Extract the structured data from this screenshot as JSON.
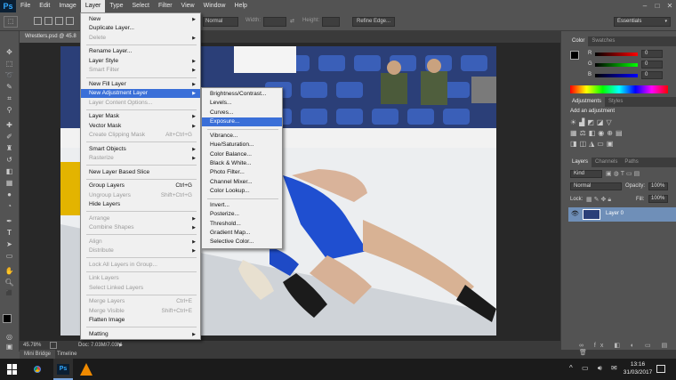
{
  "menubar": {
    "logo": "Ps",
    "items": [
      "File",
      "Edit",
      "Image",
      "Layer",
      "Type",
      "Select",
      "Filter",
      "View",
      "Window",
      "Help"
    ]
  },
  "options": {
    "mode_value": "Normal",
    "width_label": "Width:",
    "height_label": "Height:",
    "refine_edge": "Refine Edge...",
    "workspace": "Essentials"
  },
  "document": {
    "tab_title": "Wrestlers.psd @ 45.8",
    "zoom": "45.78%",
    "doc_size": "Doc: 7.03M/7.03M"
  },
  "bottom_tabs": {
    "mini_bridge": "Mini Bridge",
    "timeline": "Timeline"
  },
  "layer_menu": [
    {
      "label": "New",
      "submenu": true
    },
    {
      "label": "Duplicate Layer..."
    },
    {
      "label": "Delete",
      "submenu": true,
      "disabled": true
    },
    {
      "sep": true
    },
    {
      "label": "Rename Layer..."
    },
    {
      "label": "Layer Style",
      "submenu": true
    },
    {
      "label": "Smart Filter",
      "submenu": true,
      "disabled": true
    },
    {
      "sep": true
    },
    {
      "label": "New Fill Layer",
      "submenu": true
    },
    {
      "label": "New Adjustment Layer",
      "submenu": true,
      "highlight": true
    },
    {
      "label": "Layer Content Options...",
      "disabled": true
    },
    {
      "sep": true
    },
    {
      "label": "Layer Mask",
      "submenu": true
    },
    {
      "label": "Vector Mask",
      "submenu": true
    },
    {
      "label": "Create Clipping Mask",
      "shortcut": "Alt+Ctrl+G",
      "disabled": true
    },
    {
      "sep": true
    },
    {
      "label": "Smart Objects",
      "submenu": true
    },
    {
      "label": "Rasterize",
      "submenu": true,
      "disabled": true
    },
    {
      "sep": true
    },
    {
      "label": "New Layer Based Slice"
    },
    {
      "sep": true
    },
    {
      "label": "Group Layers",
      "shortcut": "Ctrl+G"
    },
    {
      "label": "Ungroup Layers",
      "shortcut": "Shift+Ctrl+G",
      "disabled": true
    },
    {
      "label": "Hide Layers"
    },
    {
      "sep": true
    },
    {
      "label": "Arrange",
      "submenu": true,
      "disabled": true
    },
    {
      "label": "Combine Shapes",
      "submenu": true,
      "disabled": true
    },
    {
      "sep": true
    },
    {
      "label": "Align",
      "submenu": true,
      "disabled": true
    },
    {
      "label": "Distribute",
      "submenu": true,
      "disabled": true
    },
    {
      "sep": true
    },
    {
      "label": "Lock All Layers in Group...",
      "disabled": true
    },
    {
      "sep": true
    },
    {
      "label": "Link Layers",
      "disabled": true
    },
    {
      "label": "Select Linked Layers",
      "disabled": true
    },
    {
      "sep": true
    },
    {
      "label": "Merge Layers",
      "shortcut": "Ctrl+E",
      "disabled": true
    },
    {
      "label": "Merge Visible",
      "shortcut": "Shift+Ctrl+E",
      "disabled": true
    },
    {
      "label": "Flatten Image"
    },
    {
      "sep": true
    },
    {
      "label": "Matting",
      "submenu": true
    }
  ],
  "adjustment_submenu": [
    {
      "label": "Brightness/Contrast..."
    },
    {
      "label": "Levels..."
    },
    {
      "label": "Curves..."
    },
    {
      "label": "Exposure...",
      "highlight": true
    },
    {
      "sep": true
    },
    {
      "label": "Vibrance..."
    },
    {
      "label": "Hue/Saturation..."
    },
    {
      "label": "Color Balance..."
    },
    {
      "label": "Black & White..."
    },
    {
      "label": "Photo Filter..."
    },
    {
      "label": "Channel Mixer..."
    },
    {
      "label": "Color Lookup..."
    },
    {
      "sep": true
    },
    {
      "label": "Invert..."
    },
    {
      "label": "Posterize..."
    },
    {
      "label": "Threshold..."
    },
    {
      "label": "Gradient Map..."
    },
    {
      "label": "Selective Color..."
    }
  ],
  "color_panel": {
    "tabs": [
      "Color",
      "Swatches"
    ],
    "channels": [
      {
        "name": "R",
        "value": "0"
      },
      {
        "name": "G",
        "value": "0"
      },
      {
        "name": "B",
        "value": "0"
      }
    ]
  },
  "adjustments_panel": {
    "tabs": [
      "Adjustments",
      "Styles"
    ],
    "title": "Add an adjustment"
  },
  "layers_panel": {
    "tabs": [
      "Layers",
      "Channels",
      "Paths"
    ],
    "kind": "Kind",
    "blend": "Normal",
    "opacity_label": "Opacity:",
    "opacity": "100%",
    "lock_label": "Lock:",
    "fill_label": "Fill:",
    "fill": "100%",
    "layer_name": "Layer 0"
  },
  "taskbar": {
    "time": "13:16",
    "date": "31/03/2017"
  },
  "colors": {
    "highlight": "#3a6fd8",
    "ui_bg": "#535353",
    "panel_dark": "#3c3c3c"
  }
}
